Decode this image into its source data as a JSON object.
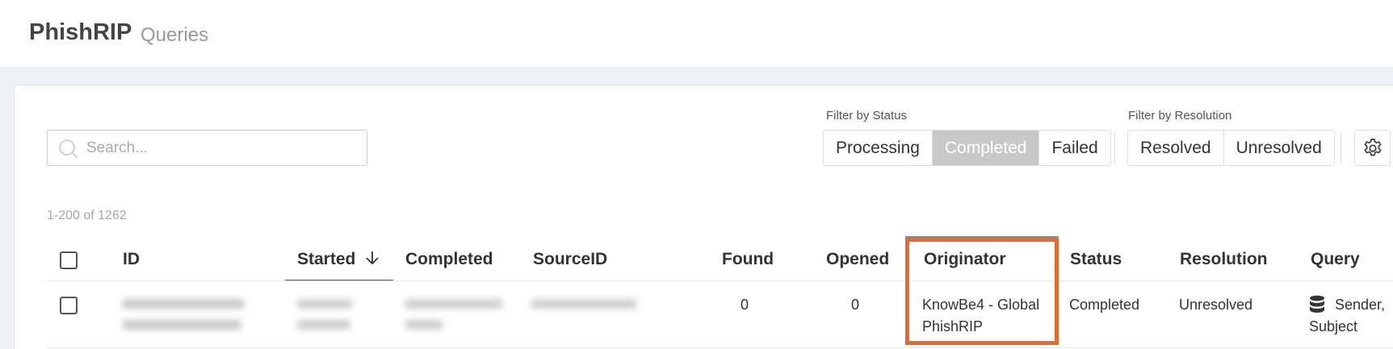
{
  "header": {
    "app_name": "PhishRIP",
    "page_name": "Queries"
  },
  "search": {
    "placeholder": "Search..."
  },
  "filters": {
    "status": {
      "label": "Filter by Status",
      "options": [
        {
          "label": "Processing",
          "active": false
        },
        {
          "label": "Completed",
          "active": true
        },
        {
          "label": "Failed",
          "active": false
        }
      ]
    },
    "resolution": {
      "label": "Filter by Resolution",
      "options": [
        {
          "label": "Resolved",
          "active": false
        },
        {
          "label": "Unresolved",
          "active": false
        }
      ]
    }
  },
  "pagination": {
    "range": "1-200 of 1262"
  },
  "table": {
    "columns": {
      "id": "ID",
      "started": "Started",
      "completed": "Completed",
      "source_id": "SourceID",
      "found": "Found",
      "opened": "Opened",
      "originator": "Originator",
      "status": "Status",
      "resolution": "Resolution",
      "query": "Query"
    },
    "sort": {
      "column": "started",
      "direction": "descending"
    },
    "rows": [
      {
        "found": "0",
        "opened": "0",
        "originator_line1": "KnowBe4 - Global",
        "originator_line2": "PhishRIP",
        "status": "Completed",
        "resolution": "Unresolved",
        "query_line1": "Sender,",
        "query_line2": "Subject"
      }
    ]
  },
  "colors": {
    "highlight": "#e8692e",
    "active_segment": "#c8c8c8",
    "background": "#eef1f6"
  }
}
